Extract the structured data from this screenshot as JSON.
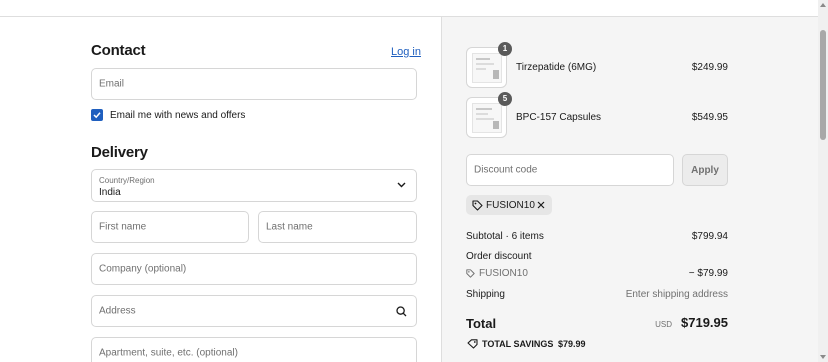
{
  "contact": {
    "heading": "Contact",
    "login_link": "Log in",
    "email_placeholder": "Email",
    "news_checkbox_label": "Email me with news and offers"
  },
  "delivery": {
    "heading": "Delivery",
    "country_label": "Country/Region",
    "country_value": "India",
    "first_name_placeholder": "First name",
    "last_name_placeholder": "Last name",
    "company_placeholder": "Company (optional)",
    "address_placeholder": "Address",
    "apartment_placeholder": "Apartment, suite, etc. (optional)"
  },
  "cart": {
    "items": [
      {
        "name": "Tirzepatide (6MG)",
        "quantity": "1",
        "price": "$249.99"
      },
      {
        "name": "BPC-157 Capsules",
        "quantity": "5",
        "price": "$549.95"
      }
    ]
  },
  "discount": {
    "placeholder": "Discount code",
    "apply_label": "Apply",
    "applied_code": "FUSION10"
  },
  "summary": {
    "subtotal_label": "Subtotal · 6 items",
    "subtotal_value": "$799.94",
    "order_discount_label": "Order discount",
    "discount_code": "FUSION10",
    "discount_value": "− $79.99",
    "shipping_label": "Shipping",
    "shipping_value": "Enter shipping address",
    "total_label": "Total",
    "currency": "USD",
    "total_value": "$719.95",
    "savings_label": "TOTAL SAVINGS",
    "savings_value": "$79.99"
  },
  "colors": {
    "accent": "#1f5fbf",
    "summary_bg": "#f5f5f5"
  }
}
